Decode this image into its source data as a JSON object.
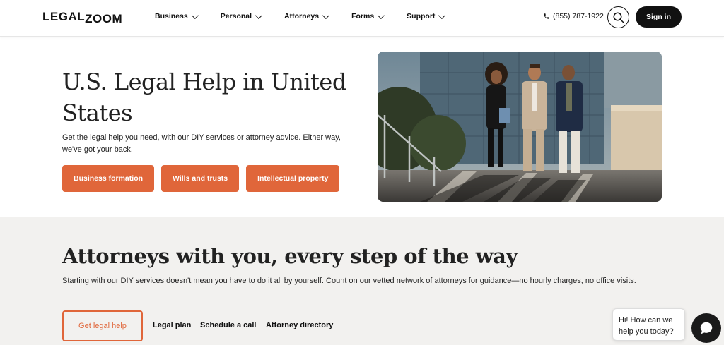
{
  "header": {
    "logo_left": "LEGAL",
    "logo_right": "ZOOM",
    "nav": [
      {
        "label": "Business"
      },
      {
        "label": "Personal"
      },
      {
        "label": "Attorneys"
      },
      {
        "label": "Forms"
      },
      {
        "label": "Support"
      }
    ],
    "phone": "(855) 787-1922",
    "sign_in": "Sign in"
  },
  "hero": {
    "title": "U.S. Legal Help in United States",
    "subtitle": "Get the legal help you need, with our DIY services or attorney advice. Either way, we've got your back.",
    "buttons": [
      "Business formation",
      "Wills and trusts",
      "Intellectual property"
    ]
  },
  "attorneys": {
    "title": "Attorneys with you, every step of the way",
    "subtitle": "Starting with our DIY services doesn't mean you have to do it all by yourself. Count on our vetted network of attorneys for guidance—no hourly charges, no office visits.",
    "cta": "Get legal help",
    "links": [
      "Legal plan",
      "Schedule a call",
      "Attorney directory"
    ]
  },
  "chat": {
    "message": "Hi! How can we help you today?"
  },
  "colors": {
    "accent": "#e0663a",
    "dark": "#111111",
    "section_bg": "#f2f1ef"
  },
  "icons": [
    "phone-icon",
    "search-icon",
    "chevron-down-icon",
    "chat-icon"
  ]
}
